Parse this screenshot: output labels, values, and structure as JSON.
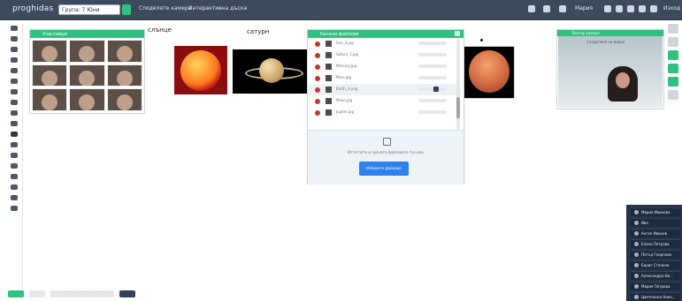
{
  "app": {
    "logo": "proghidas",
    "room_input": "Група: 7 Юни",
    "top_links": [
      "Споделете камера",
      "Интерактивна дъска"
    ],
    "user_name": "Мария",
    "exit_label": "Изход"
  },
  "canvas": {
    "labels": {
      "left": "слънце",
      "center": "сатурн"
    }
  },
  "participants_window": {
    "title": "Участници"
  },
  "files_window": {
    "title": "Качени файлове",
    "files": [
      "Sun_2.jpg",
      "Saturn_1.jpg",
      "Mercury.jpg",
      "Mars.jpg",
      "Earth_3.png",
      "Moon.jpg",
      "Jupiter.jpg"
    ],
    "selected_index": 4,
    "drop_text": "Изтеглете и пуснете файловете тук или",
    "upload_button": "Изберете файлове"
  },
  "speaker_window": {
    "title": "Лектор камера",
    "subtitle": "Споделяне на видео"
  },
  "roster": {
    "items": [
      "Мария Иванова",
      "Ива",
      "Ангел Иванов",
      "Елена Петрова",
      "Петър Георгиев",
      "Борис Стоянов",
      "Александра Ни...",
      "Мария Петрова",
      "Цветелина Нико..."
    ]
  },
  "bottom": {
    "page_buttons": [
      "",
      "",
      "",
      "",
      "",
      "",
      "",
      ""
    ]
  }
}
